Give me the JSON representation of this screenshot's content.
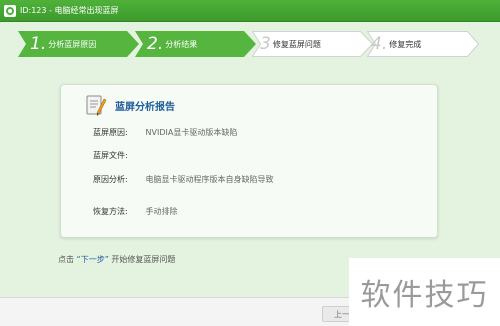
{
  "window": {
    "title": "ID:123 - 电脑经常出现蓝屏"
  },
  "steps": [
    {
      "num": "1.",
      "label": "分析蓝屏原因",
      "state": "done"
    },
    {
      "num": "2.",
      "label": "分析结果",
      "state": "current"
    },
    {
      "num": "3",
      "label": "修复蓝屏问题",
      "state": "pending"
    },
    {
      "num": "4.",
      "label": "修复完成",
      "state": "pending"
    }
  ],
  "report": {
    "title": "蓝屏分析报告",
    "rows": [
      {
        "label": "蓝屏原因:",
        "value": "NVIDIA显卡驱动版本缺陷"
      },
      {
        "label": "蓝屏文件:",
        "value": ""
      },
      {
        "label": "原因分析:",
        "value": "电脑显卡驱动程序版本自身缺陷导致"
      },
      {
        "label": "恢复方法:",
        "value": "手动排除"
      }
    ]
  },
  "hint": {
    "prefix": "点击",
    "link": "“下一步”",
    "suffix": "开始修复蓝屏问题"
  },
  "footer": {
    "prev_label": "上一"
  },
  "watermark": "软件技巧",
  "colors": {
    "title_bar": "#4fb13a",
    "active_step": "#55b53f",
    "inactive_step": "#ffffff",
    "background": "#e3f3df",
    "link": "#1f5c99"
  },
  "icons": [
    "app-logo-icon",
    "report-document-icon"
  ]
}
